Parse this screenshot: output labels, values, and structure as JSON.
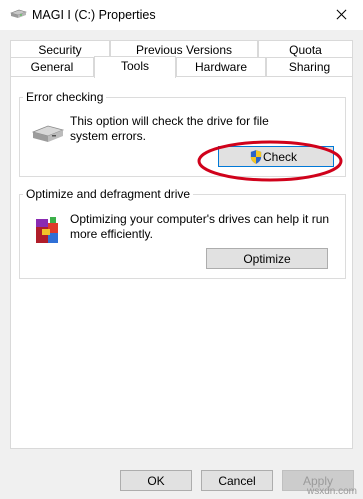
{
  "window": {
    "title": "MAGI I (C:) Properties",
    "icon": "drive-icon"
  },
  "tabs": {
    "row1": [
      "Security",
      "Previous Versions",
      "Quota"
    ],
    "row2": [
      "General",
      "Tools",
      "Hardware",
      "Sharing"
    ],
    "active": "Tools"
  },
  "error_checking": {
    "group_label": "Error checking",
    "description_line1": "This option will check the drive for file",
    "description_line2": "system errors.",
    "check_button": "Check",
    "icon": "hard-drive-icon",
    "button_icon": "uac-shield-icon"
  },
  "optimize": {
    "group_label": "Optimize and defragment drive",
    "description_line1": "Optimizing your computer's drives can help it run",
    "description_line2": "more efficiently.",
    "optimize_button": "Optimize",
    "icon": "defragment-icon"
  },
  "footer": {
    "ok": "OK",
    "cancel": "Cancel",
    "apply": "Apply"
  },
  "annotation": {
    "color": "#d0021b"
  },
  "watermark": "wsxdn.com"
}
